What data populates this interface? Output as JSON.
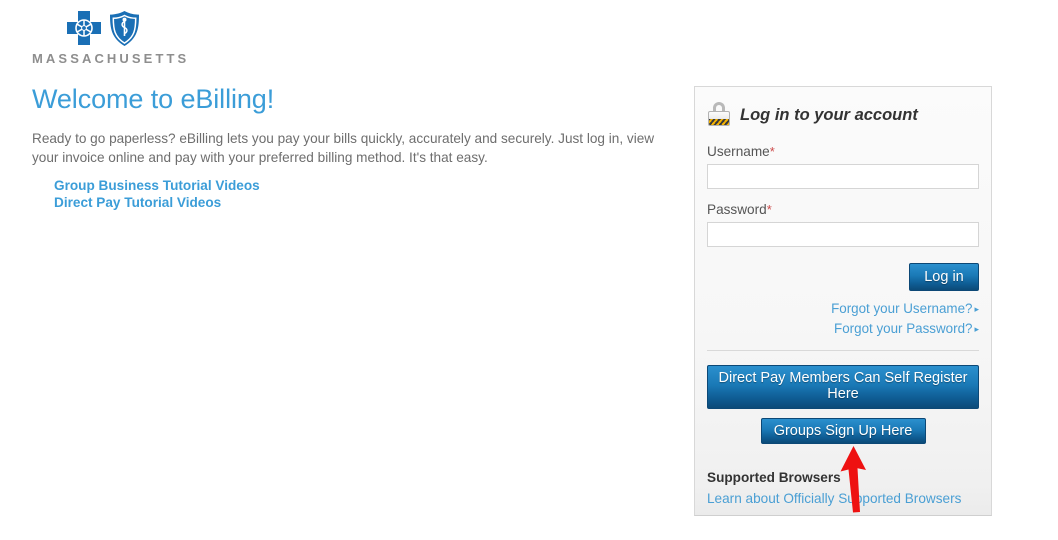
{
  "brand": {
    "logo_icons": [
      "blue-cross-icon",
      "blue-shield-icon"
    ],
    "state_name": "MASSACHUSETTS"
  },
  "welcome": {
    "title": "Welcome to eBilling!",
    "paragraph": "Ready to go paperless? eBilling lets you pay your bills quickly, accurately and securely. Just log in, view your invoice online and pay with your preferred billing method. It's that easy.",
    "links": [
      "Group Business Tutorial Videos",
      "Direct Pay Tutorial Videos"
    ]
  },
  "login_panel": {
    "icon": "padlock-icon",
    "title": "Log in to your account",
    "username": {
      "label": "Username",
      "required_marker": "*",
      "value": "",
      "placeholder": ""
    },
    "password": {
      "label": "Password",
      "required_marker": "*",
      "value": "",
      "placeholder": ""
    },
    "login_button": "Log in",
    "forgot_username": "Forgot your Username?",
    "forgot_password": "Forgot your Password?",
    "link_arrow_glyph": "▸",
    "self_register_button": "Direct Pay Members Can Self Register Here",
    "groups_signup_button": "Groups Sign Up Here",
    "supported_browsers_title": "Supported Browsers",
    "supported_browsers_link": "Learn about Officially Supported Browsers"
  },
  "annotation": {
    "arrow_color": "#ee1111",
    "points_to": "Groups Sign Up Here"
  },
  "colors": {
    "heading_blue": "#3b9dd8",
    "link_blue": "#4a9fd4",
    "button_blue_top": "#2b90ce",
    "button_blue_bottom": "#0c4a78",
    "logo_blue": "#1a6fb5",
    "required_red": "#cc4b4b"
  }
}
